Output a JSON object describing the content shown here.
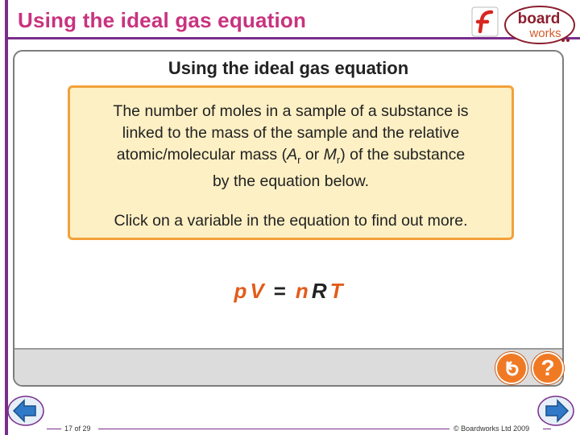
{
  "header": {
    "title": "Using the ideal gas equation",
    "logo_line1": "board",
    "logo_line2": "works"
  },
  "panel": {
    "title": "Using the ideal gas equation",
    "info_lines": [
      "The number of moles in a sample of a substance is",
      "linked to the mass of the sample and the relative",
      "atomic/molecular mass (",
      "A",
      "r",
      " or ",
      "M",
      "r",
      ") of the substance",
      "by the equation below."
    ],
    "instruction": "Click on a variable in the equation to find out more."
  },
  "equation": {
    "p": "p",
    "V": "V",
    "equals": "=",
    "n": "n",
    "R": "R",
    "T": "T"
  },
  "buttons": {
    "help_label": "?"
  },
  "footer": {
    "page": "17 of 29",
    "copyright": "© Boardworks Ltd 2009"
  },
  "colors": {
    "header_title": "#c8337f",
    "accent_purple": "#7a2e8c",
    "box_border": "#f2a13a",
    "box_fill": "#fdf0c4",
    "variable": "#e25c1a",
    "button_orange": "#f07a24",
    "nav_blue": "#2f79c8"
  },
  "icons": [
    "flash-icon",
    "boardworks-logo",
    "reset-icon",
    "help-icon",
    "prev-arrow-icon",
    "next-arrow-icon"
  ]
}
